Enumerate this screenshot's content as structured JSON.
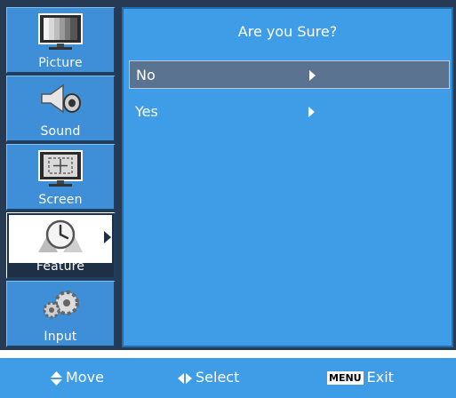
{
  "sidebar": {
    "tabs": [
      {
        "label": "Picture",
        "icon": "picture-icon"
      },
      {
        "label": "Sound",
        "icon": "speaker-icon"
      },
      {
        "label": "Screen",
        "icon": "screen-icon"
      },
      {
        "label": "Feature",
        "icon": "clock-icon",
        "selected": true
      },
      {
        "label": "Input",
        "icon": "gears-icon"
      }
    ]
  },
  "dialog": {
    "title": "Are you Sure?",
    "options": [
      {
        "label": "No",
        "highlighted": true
      },
      {
        "label": "Yes",
        "highlighted": false
      }
    ]
  },
  "helpbar": {
    "move_label": "Move",
    "select_label": "Select",
    "menu_key": "MENU",
    "exit_label": "Exit"
  },
  "colors": {
    "panel_blue": "#3e9de6",
    "highlight": "#5a7390",
    "frame": "#273a54"
  }
}
